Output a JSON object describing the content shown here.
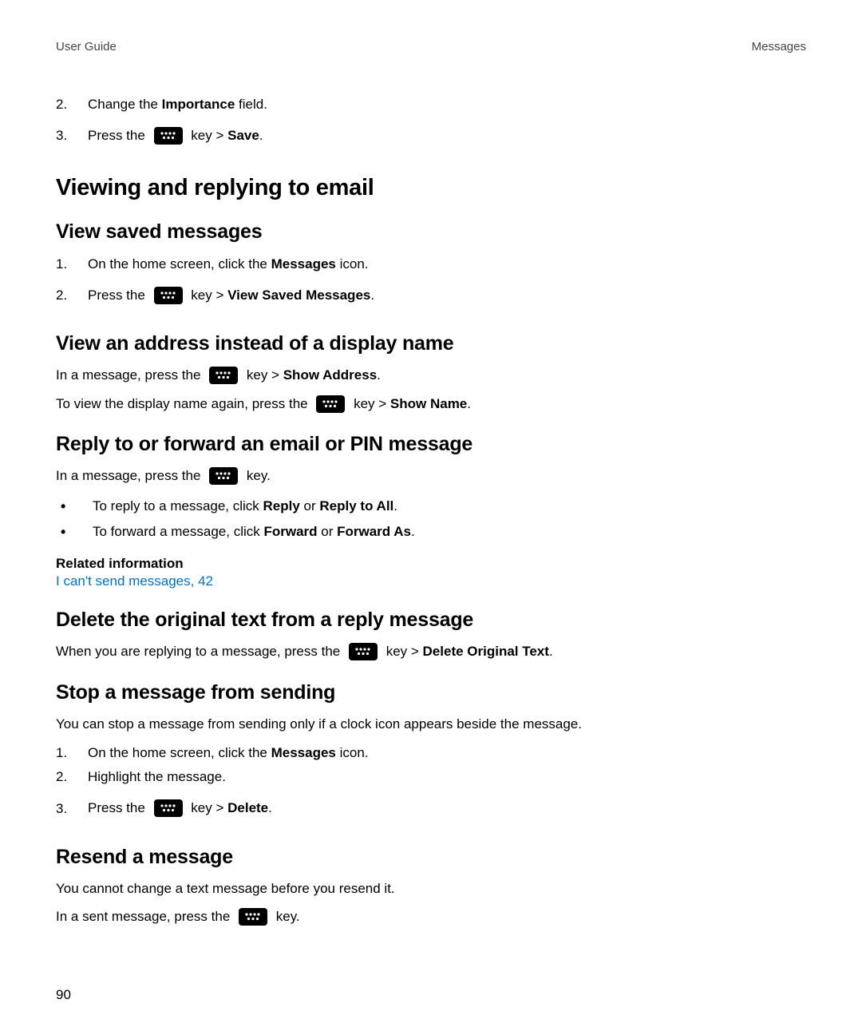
{
  "header": {
    "left": "User Guide",
    "right": "Messages"
  },
  "top_steps": {
    "s2": {
      "num": "2.",
      "t1": "Change the ",
      "b1": "Importance",
      "t2": " field."
    },
    "s3": {
      "num": "3.",
      "t1": "Press the ",
      "t2": " key > ",
      "b1": "Save",
      "t3": "."
    }
  },
  "h_view_reply": "Viewing and replying to email",
  "h_view_saved": "View saved messages",
  "saved_steps": {
    "s1": {
      "num": "1.",
      "t1": "On the home screen, click the ",
      "b1": "Messages",
      "t2": " icon."
    },
    "s2": {
      "num": "2.",
      "t1": "Press the ",
      "t2": " key > ",
      "b1": "View Saved Messages",
      "t3": "."
    }
  },
  "h_addr": "View an address instead of a display name",
  "addr_p1": {
    "t1": "In a message, press the ",
    "t2": " key > ",
    "b1": "Show Address",
    "t3": "."
  },
  "addr_p2": {
    "t1": "To view the display name again, press the ",
    "t2": " key > ",
    "b1": "Show Name",
    "t3": "."
  },
  "h_reply_fwd": "Reply to or forward an email or PIN message",
  "rf_intro": {
    "t1": "In a message, press the ",
    "t2": " key."
  },
  "rf_bullets": {
    "b1": {
      "t1": "To reply to a message, click ",
      "bold1": "Reply",
      "t2": " or ",
      "bold2": "Reply to All",
      "t3": "."
    },
    "b2": {
      "t1": "To forward a message, click ",
      "bold1": "Forward",
      "t2": " or ",
      "bold2": "Forward As",
      "t3": "."
    }
  },
  "rel_info": "Related information",
  "rel_link": "I can't send messages,",
  "rel_page": " 42",
  "h_delete_orig": "Delete the original text from a reply message",
  "del_p": {
    "t1": "When you are replying to a message, press the ",
    "t2": " key > ",
    "b1": "Delete Original Text",
    "t3": "."
  },
  "h_stop": "Stop a message from sending",
  "stop_intro": "You can stop a message from sending only if a clock icon appears beside the message.",
  "stop_steps": {
    "s1": {
      "num": "1.",
      "t1": "On the home screen, click the ",
      "b1": "Messages",
      "t2": " icon."
    },
    "s2": {
      "num": "2.",
      "t1": "Highlight the message."
    },
    "s3": {
      "num": "3.",
      "t1": "Press the ",
      "t2": " key > ",
      "b1": "Delete",
      "t3": "."
    }
  },
  "h_resend": "Resend a message",
  "resend_intro": "You cannot change a text message before you resend it.",
  "resend_p": {
    "t1": "In a sent message, press the ",
    "t2": " key."
  },
  "page_number": "90"
}
